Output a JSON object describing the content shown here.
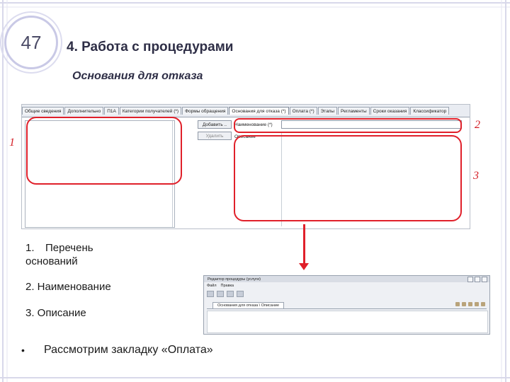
{
  "slide": {
    "number": "47",
    "title": "4. Работа с процедурами",
    "subtitle": "Основания для отказа"
  },
  "app_screenshot": {
    "tabs": [
      "Общие сведения",
      "Дополнительно",
      "П1А",
      "Категории получателей (*)",
      "Формы обращения",
      "Основания для отказа (*)",
      "Оплата (*)",
      "Этапы",
      "Регламенты",
      "Сроки оказания",
      "Классификатор"
    ],
    "active_tab_index": 5,
    "buttons": {
      "add": "Добавить ..",
      "delete": "Удалить"
    },
    "fields": {
      "name_label": "Наименование (*)",
      "description_label": "Описание"
    }
  },
  "callouts": {
    "labels": [
      "1",
      "2",
      "3"
    ]
  },
  "list": {
    "item1_num": "1.",
    "item1_line1": "Перечень",
    "item1_line2": "оснований",
    "item2": "2. Наименование",
    "item3": "3. Описание",
    "bullet_symbol": "•",
    "bullet_text": "Рассмотрим закладку «Оплата»"
  },
  "mini_window": {
    "title": "Редактор процедуры (услуги)",
    "menu": [
      "Файл",
      "Правка"
    ],
    "tab_label": "Основания для отказа \\ Описание"
  },
  "colors": {
    "callout_red": "#e0202a",
    "title_text": "#2e2e46"
  }
}
